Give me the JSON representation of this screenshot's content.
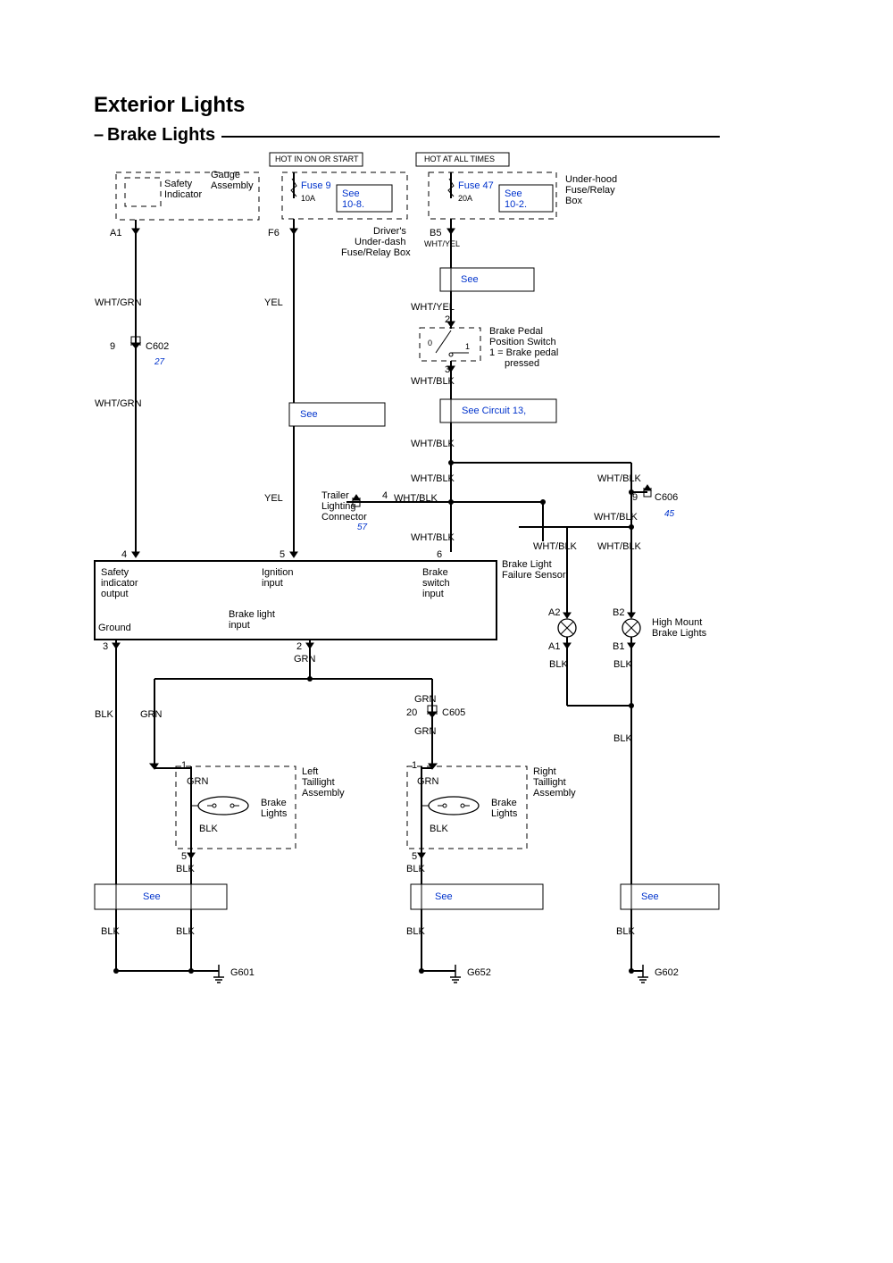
{
  "title": "Exterior Lights",
  "subtitle_prefix": "–",
  "subtitle": "Brake Lights",
  "top_boxes": {
    "hot_on_start": "HOT IN ON OR START",
    "hot_all_times": "HOT AT ALL TIMES"
  },
  "fuses": {
    "fuse9": {
      "name": "Fuse 9",
      "rating": "10A",
      "see": "See",
      "ref": "10-8."
    },
    "fuse47": {
      "name": "Fuse 47",
      "rating": "20A",
      "see": "See",
      "ref": "10-2."
    }
  },
  "components": {
    "gauge": {
      "line1": "Gauge",
      "line2": "Assembly"
    },
    "safety_ind": {
      "line1": "Safety",
      "line2": "Indicator"
    },
    "drivers_box": {
      "line1": "Driver's",
      "line2": "Under-dash",
      "line3": "Fuse/Relay Box"
    },
    "under_hood": {
      "line1": "Under-hood",
      "line2": "Fuse/Relay",
      "line3": "Box"
    },
    "brake_pedal": {
      "line1": "Brake Pedal",
      "line2": "Position Switch",
      "line3": "1 = Brake pedal",
      "line4": "pressed"
    },
    "trailer": {
      "line1": "Trailer",
      "line2": "Lighting",
      "line3": "Connector"
    },
    "brake_sensor": {
      "line1": "Brake Light",
      "line2": "Failure Sensor"
    },
    "high_mount": {
      "line1": "High Mount",
      "line2": "Brake Lights"
    },
    "left_tail": {
      "line1": "Left",
      "line2": "Taillight",
      "line3": "Assembly"
    },
    "right_tail": {
      "line1": "Right",
      "line2": "Taillight",
      "line3": "Assembly"
    },
    "brake_lights_l": {
      "line1": "Brake",
      "line2": "Lights"
    },
    "brake_lights_r": {
      "line1": "Brake",
      "line2": "Lights"
    }
  },
  "signals": {
    "safety_out": {
      "line1": "Safety",
      "line2": "indicator",
      "line3": "output"
    },
    "ignition": {
      "line1": "Ignition",
      "line2": "input"
    },
    "brake_sw": {
      "line1": "Brake",
      "line2": "switch",
      "line3": "input"
    },
    "brake_light_in": {
      "line1": "Brake light",
      "line2": "input"
    },
    "gnd_label": "Ground"
  },
  "pins": {
    "a1": "A1",
    "f6": "F6",
    "b5": "B5",
    "p2": "2",
    "p3": "3",
    "p4": "4",
    "p5": "5",
    "p6": "6",
    "p9": "9",
    "a2": "A2",
    "b2": "B2",
    "a1b": "A1",
    "b1": "B1",
    "p1": "1",
    "p5b": "5",
    "p20": "20",
    "p9b": "9"
  },
  "wires": {
    "wht_grn": "WHT/GRN",
    "yel": "YEL",
    "wht_yel": "WHT/YEL",
    "wht_blk": "WHT/BLK",
    "grn": "GRN",
    "blk": "BLK"
  },
  "connectors": {
    "c602": "C602",
    "c605": "C605",
    "c606": "C606"
  },
  "grounds": {
    "g601": "G601",
    "g652": "G652",
    "g602": "G602"
  },
  "refs": {
    "see": "See",
    "see_circuit13": "See Circuit 13,",
    "r27": "27",
    "r45": "45",
    "r57": "57"
  },
  "switch_pos": {
    "p0": "0",
    "p1": "1"
  }
}
